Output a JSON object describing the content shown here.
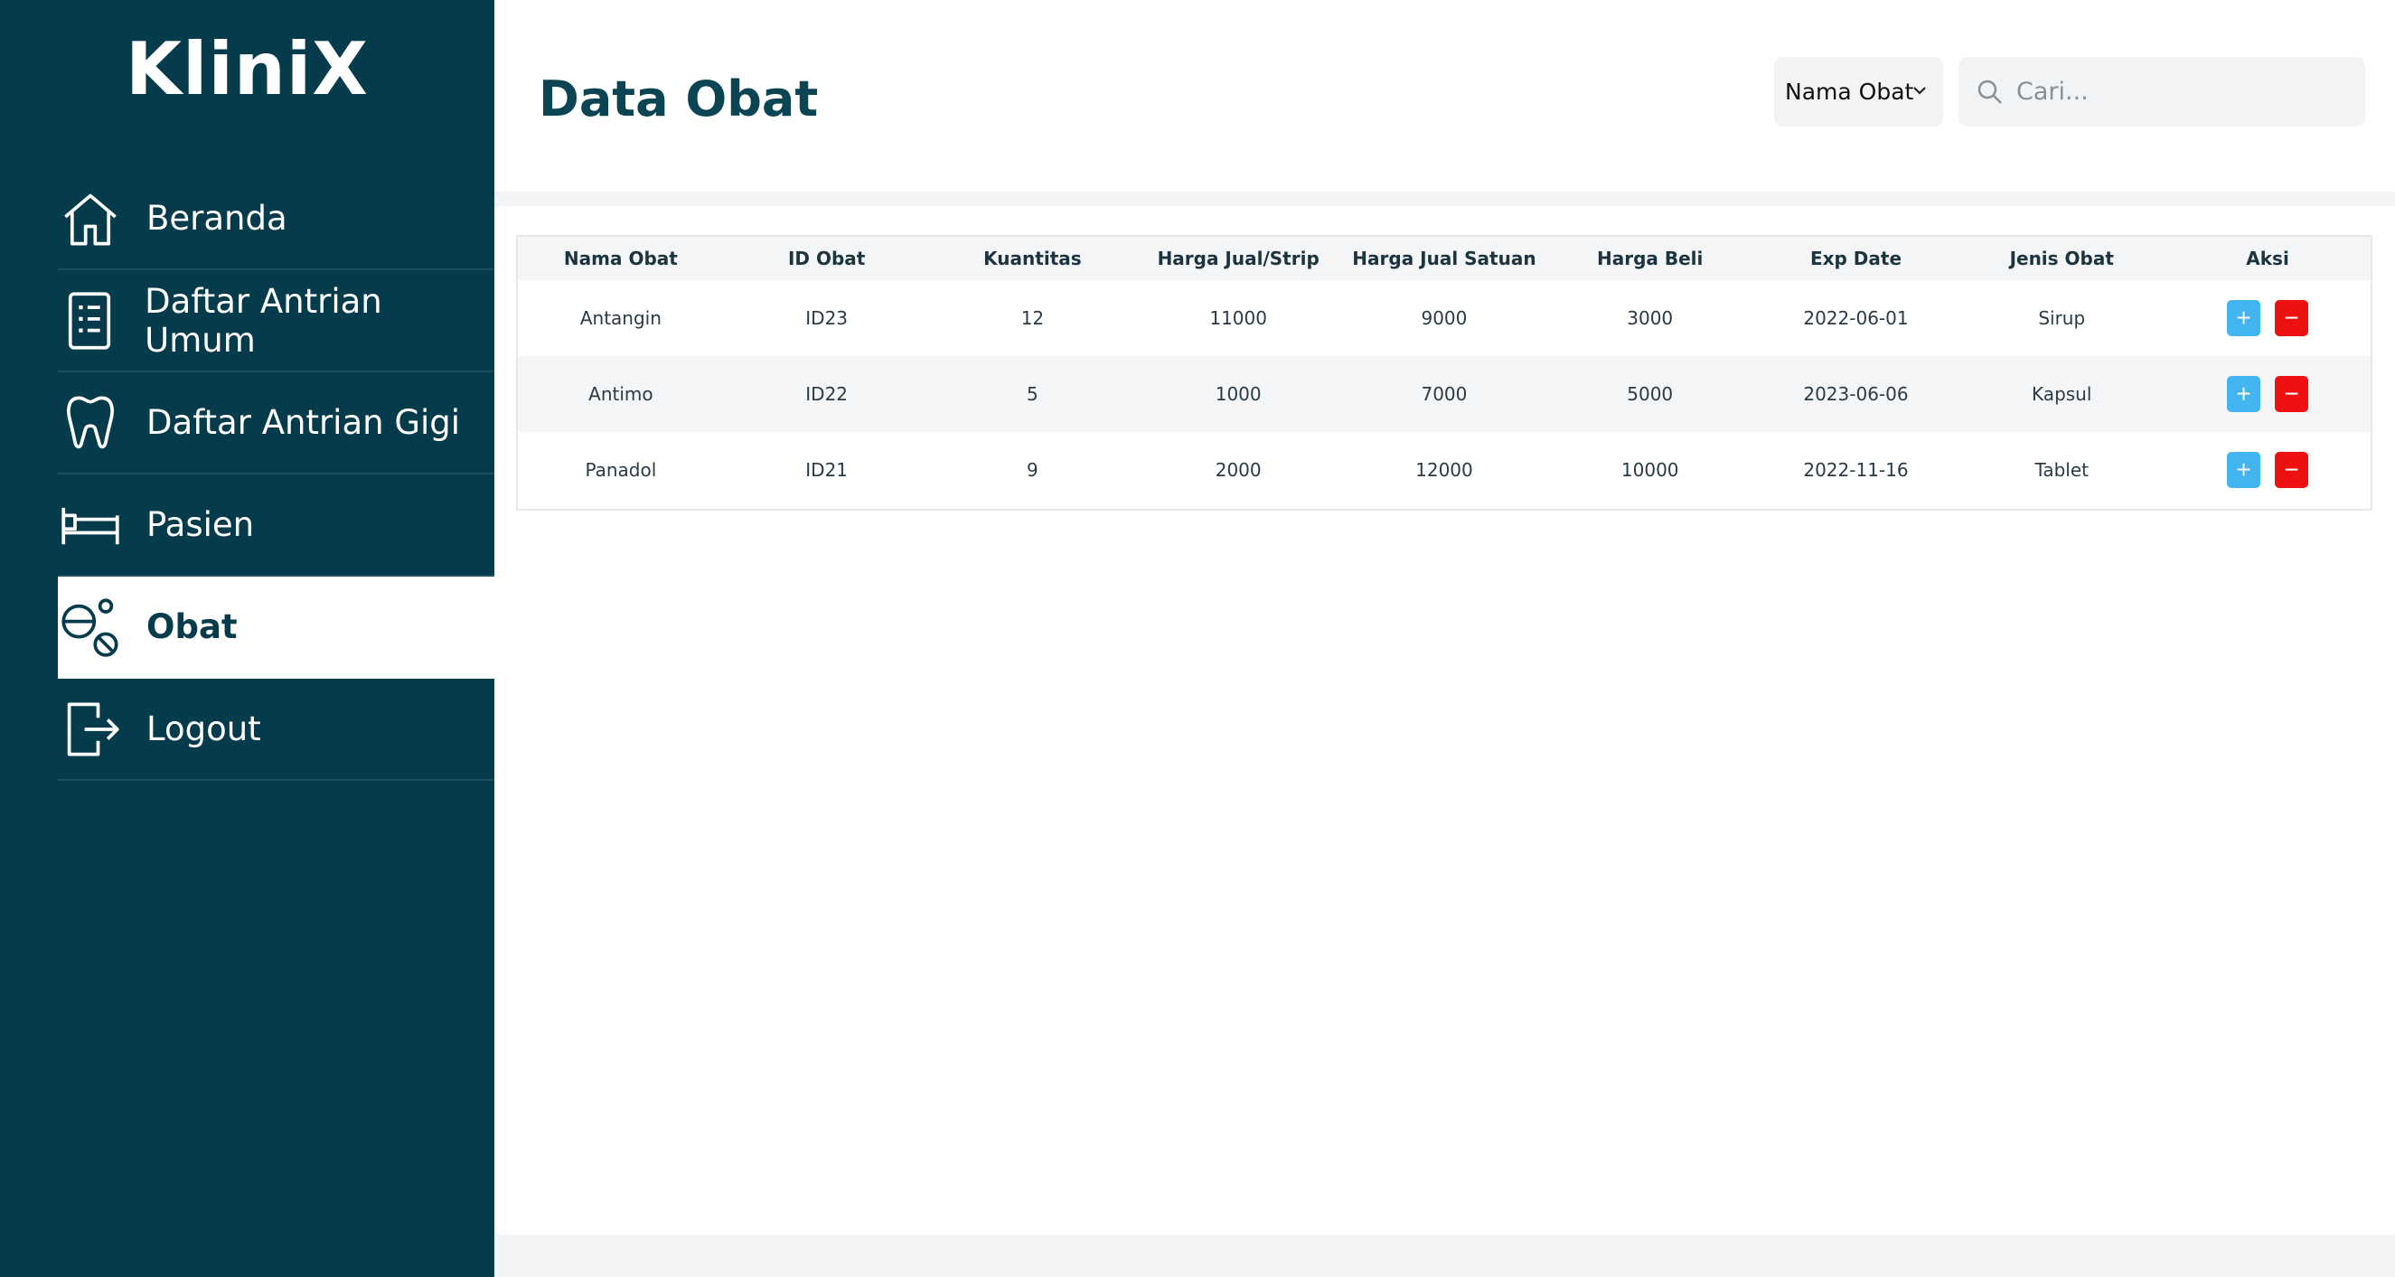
{
  "app": {
    "logo": "KliniX"
  },
  "sidebar": {
    "items": [
      {
        "label": "Beranda",
        "icon": "home-icon",
        "active": false
      },
      {
        "label": "Daftar Antrian Umum",
        "icon": "list-icon",
        "active": false
      },
      {
        "label": "Daftar Antrian Gigi",
        "icon": "tooth-icon",
        "active": false
      },
      {
        "label": "Pasien",
        "icon": "bed-icon",
        "active": false
      },
      {
        "label": "Obat",
        "icon": "pills-icon",
        "active": true
      },
      {
        "label": "Logout",
        "icon": "logout-icon",
        "active": false
      }
    ]
  },
  "header": {
    "title": "Data Obat",
    "filter": {
      "selected": "Nama Obat"
    },
    "search": {
      "placeholder": "Cari...",
      "value": ""
    }
  },
  "table": {
    "columns": [
      "Nama Obat",
      "ID Obat",
      "Kuantitas",
      "Harga Jual/Strip",
      "Harga Jual Satuan",
      "Harga Beli",
      "Exp Date",
      "Jenis Obat",
      "Aksi"
    ],
    "rows": [
      [
        "Antangin",
        "ID23",
        "12",
        "11000",
        "9000",
        "3000",
        "2022-06-01",
        "Sirup"
      ],
      [
        "Antimo",
        "ID22",
        "5",
        "1000",
        "7000",
        "5000",
        "2023-06-06",
        "Kapsul"
      ],
      [
        "Panadol",
        "ID21",
        "9",
        "2000",
        "12000",
        "10000",
        "2022-11-16",
        "Tablet"
      ]
    ],
    "actions": {
      "add_symbol": "+",
      "remove_symbol": "−"
    }
  },
  "colors": {
    "sidebar_bg": "#053b4a",
    "title": "#0b4452",
    "add_button": "#42b4f0",
    "remove_button": "#ee1111"
  }
}
